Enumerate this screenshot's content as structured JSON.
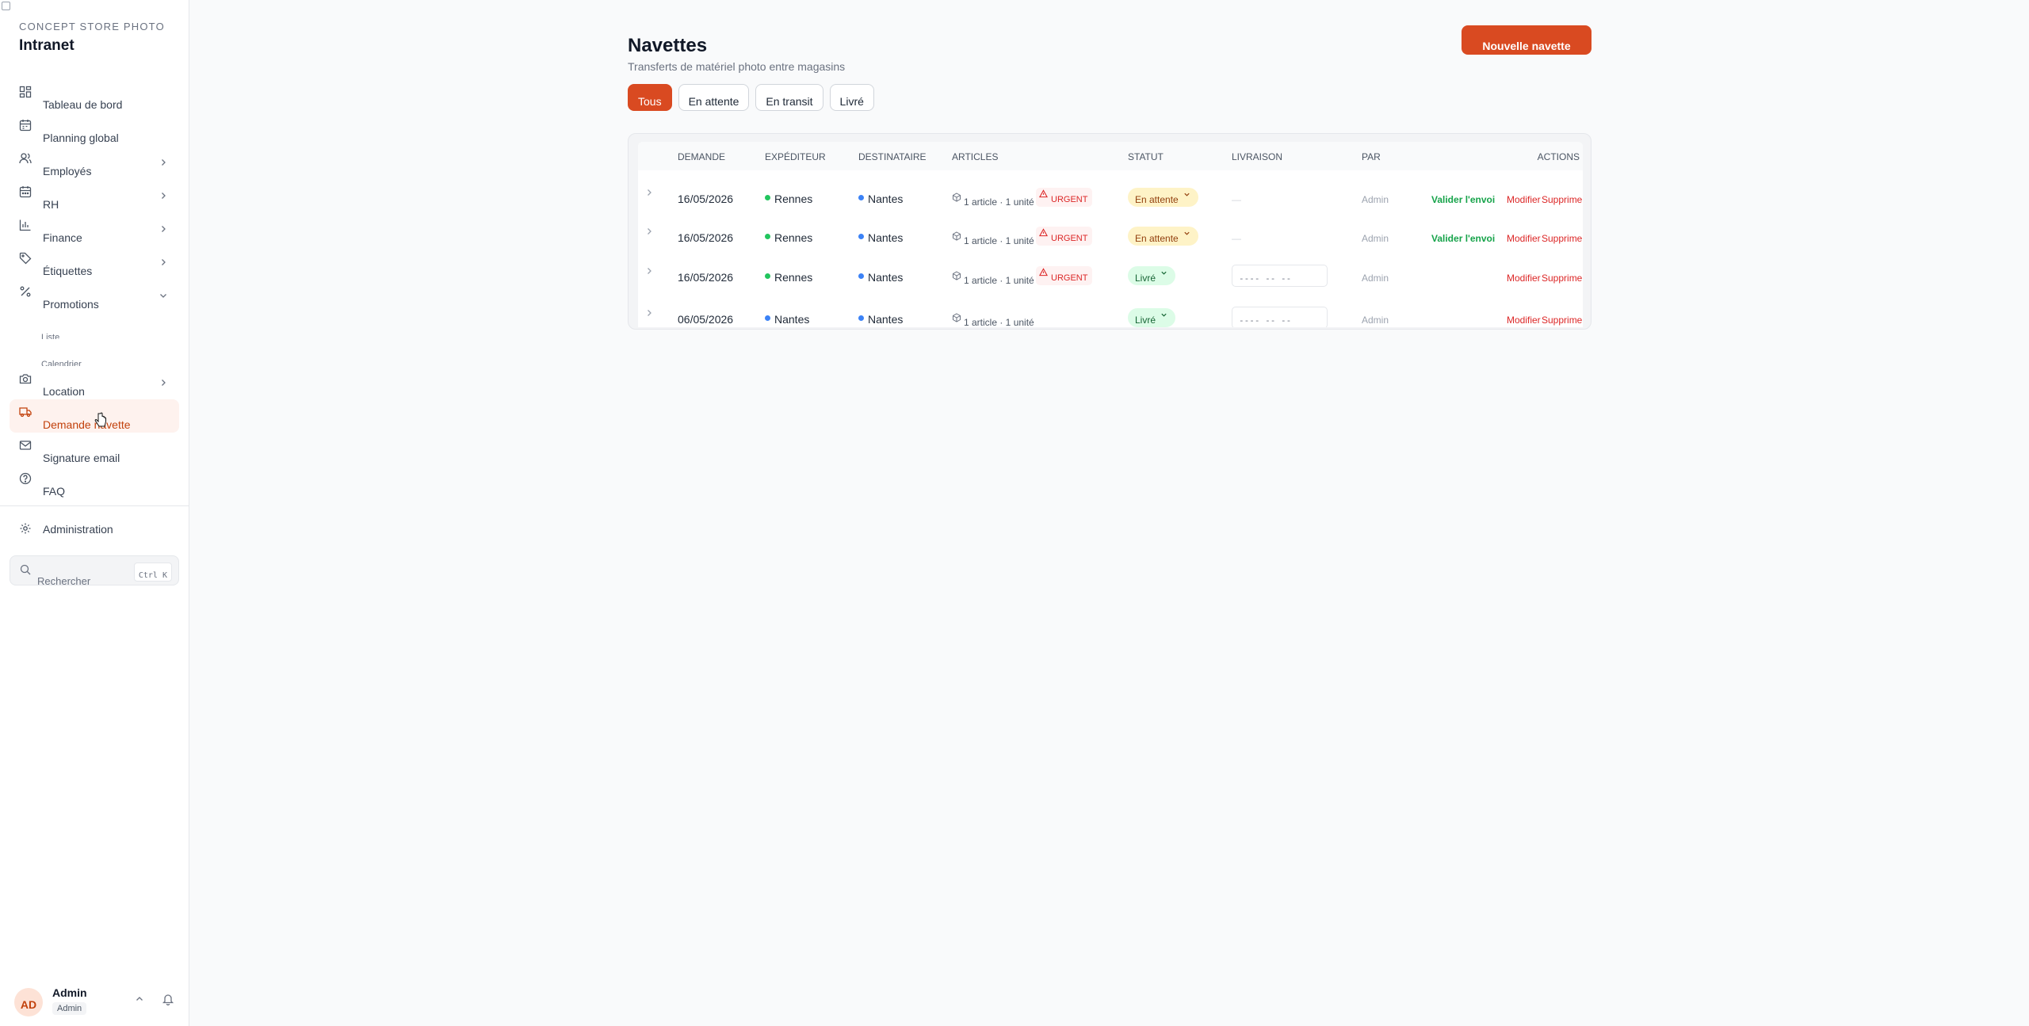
{
  "sidebar": {
    "brand_kicker": "CONCEPT STORE PHOTO",
    "brand_title": "Intranet",
    "items": [
      {
        "label": "Tableau de bord",
        "icon": "dashboard-icon"
      },
      {
        "label": "Planning global",
        "icon": "calendar-icon"
      },
      {
        "label": "Employés",
        "icon": "users-icon"
      },
      {
        "label": "RH",
        "icon": "calendar-days-icon"
      },
      {
        "label": "Finance",
        "icon": "bar-chart-icon"
      },
      {
        "label": "Étiquettes",
        "icon": "tag-icon"
      },
      {
        "label": "Promotions",
        "icon": "percent-icon"
      },
      {
        "label": "Location",
        "icon": "camera-icon"
      },
      {
        "label": "Demande navette",
        "icon": "truck-icon"
      },
      {
        "label": "Signature email",
        "icon": "mail-icon"
      },
      {
        "label": "FAQ",
        "icon": "help-circle-icon"
      }
    ],
    "promotions_sub": [
      "Liste",
      "Calendrier"
    ],
    "administration": "Administration",
    "search_placeholder": "Rechercher",
    "search_shortcut": "Ctrl K",
    "user": {
      "initials": "AD",
      "name": "Admin",
      "role": "Admin"
    }
  },
  "header": {
    "title": "Navettes",
    "subtitle": "Transferts de matériel photo entre magasins",
    "new_button": "Nouvelle navette"
  },
  "tabs": [
    "Tous",
    "En attente",
    "En transit",
    "Livré"
  ],
  "table": {
    "columns": {
      "demande": "DEMANDE",
      "expediteur": "EXPÉDITEUR",
      "destinataire": "DESTINATAIRE",
      "articles": "ARTICLES",
      "statut": "STATUT",
      "livraison": "LIVRAISON",
      "par": "PAR",
      "actions": "ACTIONS"
    },
    "rows": [
      {
        "date": "16/05/2026",
        "sender": "Rennes",
        "recipient": "Nantes",
        "articles": "1 article · 1 unité",
        "urgent": "URGENT",
        "status": "En attente",
        "delivery": "—",
        "by": "Admin",
        "validate": "Valider l'envoi",
        "edit": "Modifier",
        "delete": "Supprimer"
      },
      {
        "date": "16/05/2026",
        "sender": "Rennes",
        "recipient": "Nantes",
        "articles": "1 article · 1 unité",
        "urgent": "URGENT",
        "status": "En attente",
        "delivery": "—",
        "by": "Admin",
        "validate": "Valider l'envoi",
        "edit": "Modifier",
        "delete": "Supprimer"
      },
      {
        "date": "16/05/2026",
        "sender": "Rennes",
        "recipient": "Nantes",
        "articles": "1 article · 1 unité",
        "urgent": "URGENT",
        "status": "Livré",
        "delivery": "---- -- --",
        "by": "Admin",
        "edit": "Modifier",
        "delete": "Supprimer"
      },
      {
        "date": "06/05/2026",
        "sender": "Nantes",
        "recipient": "Nantes",
        "articles": "1 article · 1 unité",
        "status": "Livré",
        "delivery": "---- -- --",
        "by": "Admin",
        "edit": "Modifier",
        "delete": "Supprimer"
      }
    ]
  },
  "colors": {
    "accent": "#d94a21",
    "pending": "#fef3c7",
    "delivered": "#dcfce7",
    "urgent": "#dc2626"
  }
}
